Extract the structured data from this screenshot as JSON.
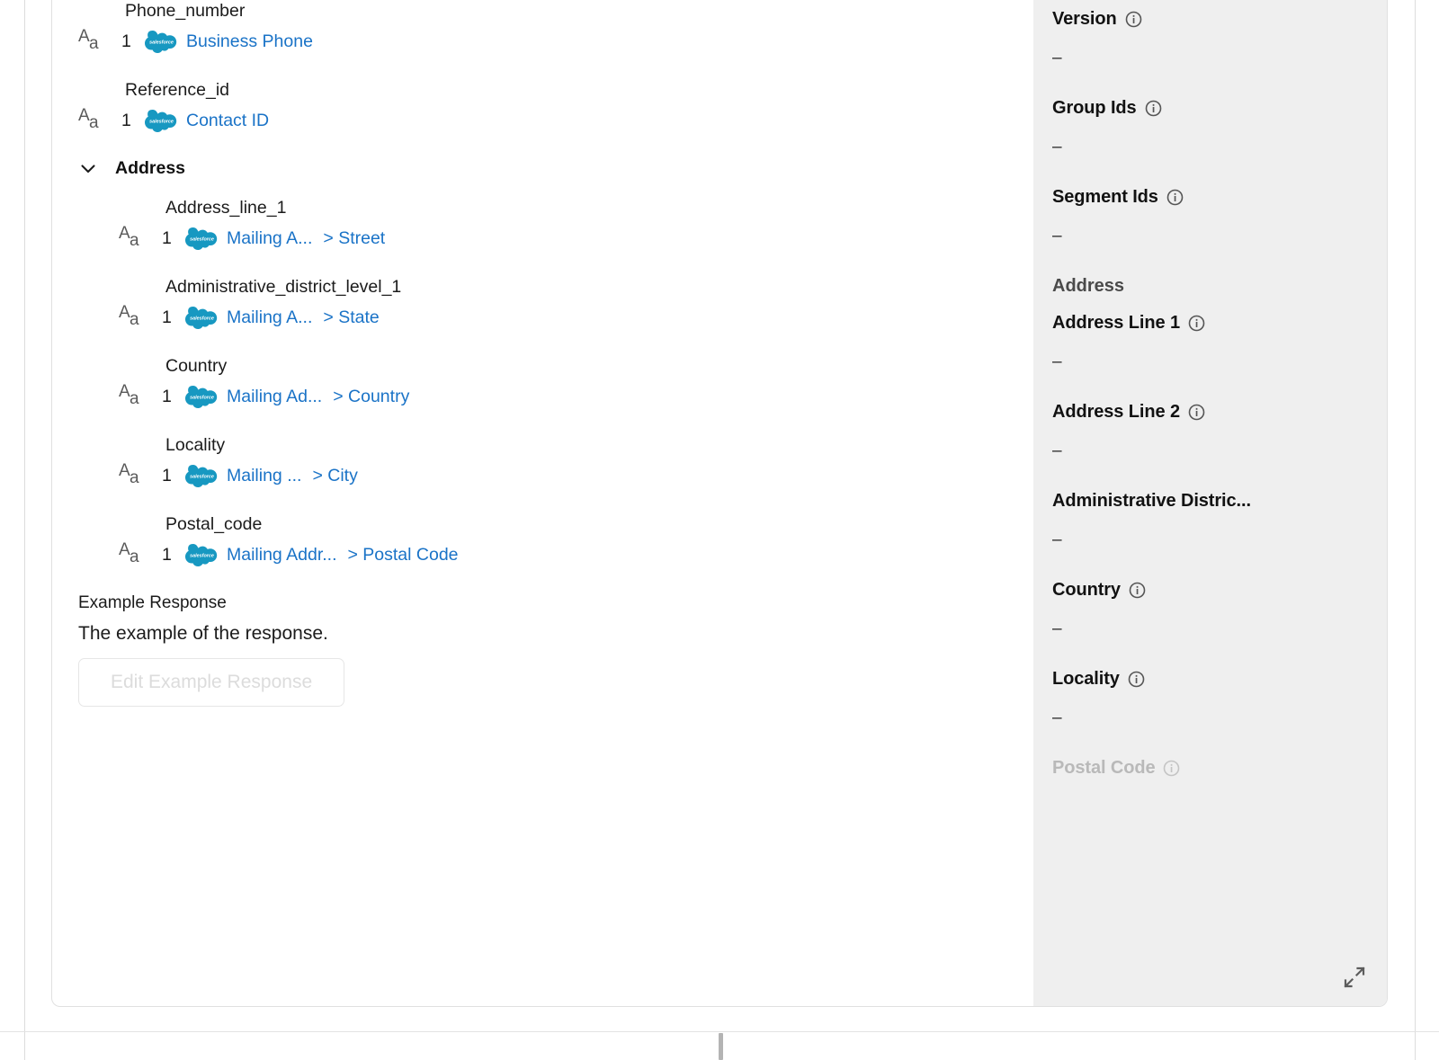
{
  "mapping": {
    "fields": [
      {
        "label": "Phone_number",
        "count": "1",
        "source_icon": "salesforce-logo",
        "source": "Business Phone",
        "sub": "",
        "nested": false
      },
      {
        "label": "Reference_id",
        "count": "1",
        "source_icon": "salesforce-logo",
        "source": "Contact ID",
        "sub": "",
        "nested": false
      }
    ],
    "section": {
      "title": "Address",
      "chevron": "chevron-down-icon",
      "fields": [
        {
          "label": "Address_line_1",
          "count": "1",
          "source_icon": "salesforce-logo",
          "source": "Mailing A...",
          "sub": "> Street",
          "nested": true
        },
        {
          "label": "Administrative_district_level_1",
          "count": "1",
          "source_icon": "salesforce-logo",
          "source": "Mailing A...",
          "sub": "> State",
          "nested": true
        },
        {
          "label": "Country",
          "count": "1",
          "source_icon": "salesforce-logo",
          "source": "Mailing Ad...",
          "sub": "> Country",
          "nested": true
        },
        {
          "label": "Locality",
          "count": "1",
          "source_icon": "salesforce-logo",
          "source": "Mailing ...",
          "sub": "> City",
          "nested": true
        },
        {
          "label": "Postal_code",
          "count": "1",
          "source_icon": "salesforce-logo",
          "source": "Mailing Addr...",
          "sub": "> Postal Code",
          "nested": true
        }
      ]
    },
    "example": {
      "title": "Example Response",
      "description": "The example of the response.",
      "button_label": "Edit Example Response"
    }
  },
  "properties": {
    "items": [
      {
        "label": "Version",
        "value": "–",
        "info": true,
        "type": "prop",
        "faded": false
      },
      {
        "label": "Group Ids",
        "value": "–",
        "info": true,
        "type": "prop",
        "faded": false
      },
      {
        "label": "Segment Ids",
        "value": "–",
        "info": true,
        "type": "prop",
        "faded": false
      },
      {
        "label": "Address",
        "value": "",
        "info": false,
        "type": "section",
        "faded": false
      },
      {
        "label": "Address Line 1",
        "value": "–",
        "info": true,
        "type": "prop",
        "faded": false
      },
      {
        "label": "Address Line 2",
        "value": "–",
        "info": true,
        "type": "prop",
        "faded": false
      },
      {
        "label": "Administrative Distric...",
        "value": "–",
        "info": false,
        "type": "prop",
        "faded": false
      },
      {
        "label": "Country",
        "value": "–",
        "info": true,
        "type": "prop",
        "faded": false
      },
      {
        "label": "Locality",
        "value": "–",
        "info": true,
        "type": "prop",
        "faded": false
      },
      {
        "label": "Postal Code",
        "value": "",
        "info": true,
        "type": "prop",
        "faded": true
      }
    ],
    "expand_icon": "expand-diagonal-icon"
  },
  "colors": {
    "link": "#1a73c7",
    "salesforce_blue": "#1798c1",
    "panel_bg": "#efefef",
    "card_border": "#e0e0e0"
  }
}
